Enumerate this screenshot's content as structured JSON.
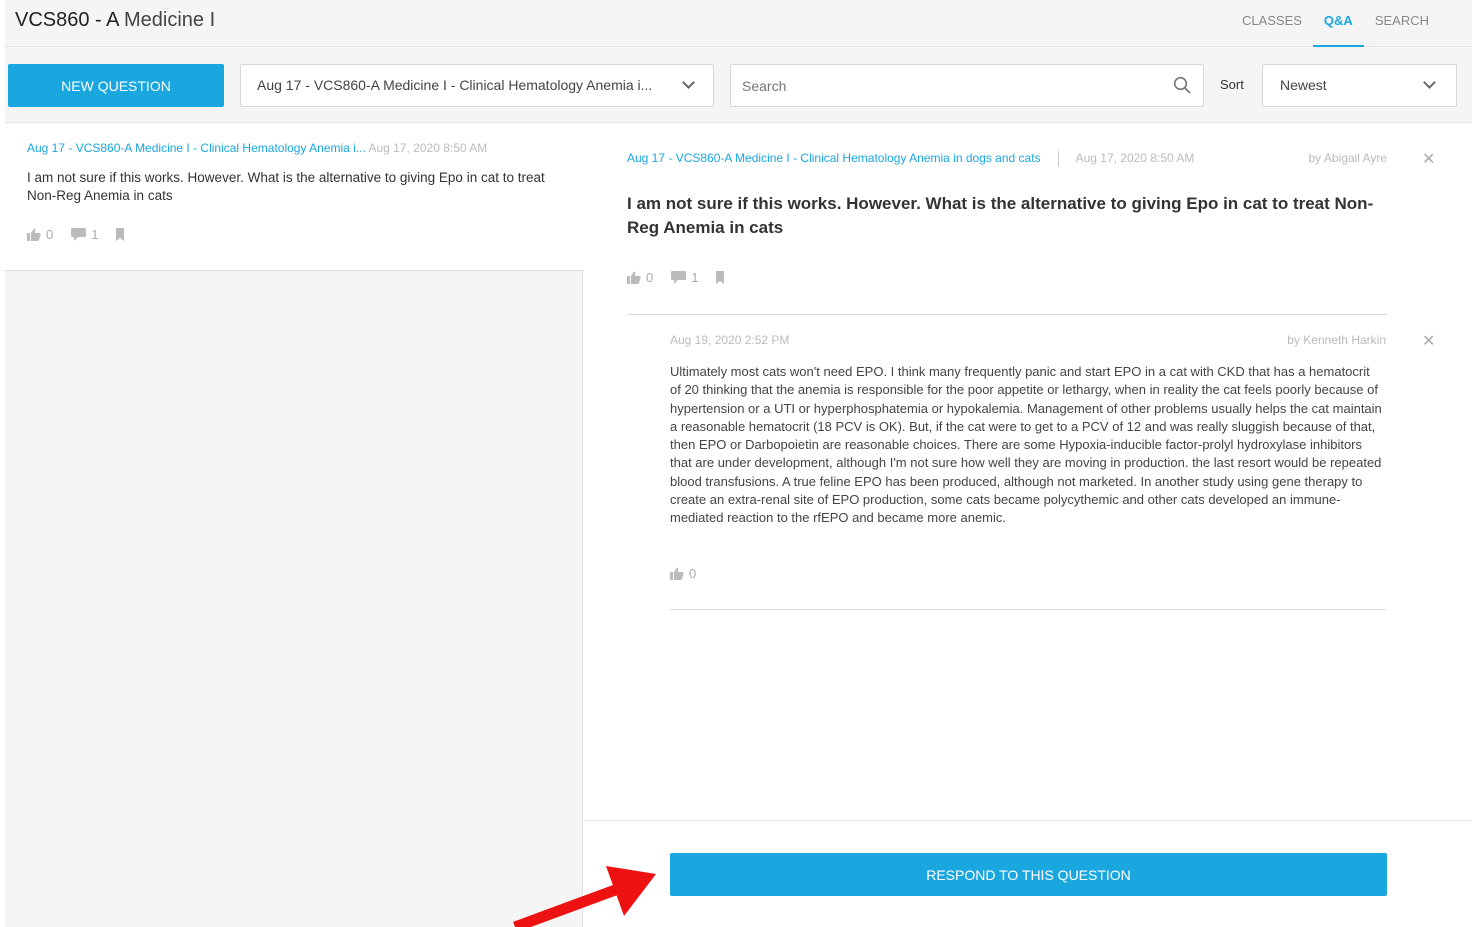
{
  "header": {
    "course_code": "VCS860 - A",
    "course_name": "Medicine I",
    "tabs": [
      "CLASSES",
      "Q&A",
      "SEARCH"
    ],
    "active_tab": "Q&A"
  },
  "toolbar": {
    "new_question_label": "NEW QUESTION",
    "class_selected": "Aug 17 - VCS860-A Medicine I - Clinical Hematology Anemia i...",
    "search_placeholder": "Search",
    "sort_label": "Sort",
    "sort_selected": "Newest"
  },
  "question_list": [
    {
      "class_link": "Aug 17 - VCS860-A Medicine I - Clinical Hematology Anemia i...",
      "timestamp": "Aug 17, 2020 8:50 AM",
      "text": "I am not sure if this works. However. What is the alternative to giving Epo in cat to treat Non-Reg Anemia in cats",
      "likes": "0",
      "comments": "1"
    }
  ],
  "question_detail": {
    "class_link": "Aug 17 - VCS860-A Medicine I - Clinical Hematology Anemia in dogs and cats",
    "timestamp": "Aug 17, 2020 8:50 AM",
    "author": "by Abigail Ayre",
    "title": "I am not sure if this works. However. What is the alternative to giving Epo in cat to treat Non-Reg Anemia in cats",
    "likes": "0",
    "comments": "1"
  },
  "answer": {
    "timestamp": "Aug 19, 2020 2:52 PM",
    "author": "by Kenneth Harkin",
    "body": "Ultimately most cats won't need EPO. I think many frequently panic and start EPO in a cat with CKD that has a hematocrit of 20 thinking that the anemia is responsible for the poor appetite or lethargy, when in reality the cat feels poorly because of hypertension or a UTI or hyperphosphatemia or hypokalemia. Management of other problems usually helps the cat maintain a reasonable hematocrit (18 PCV is OK). But, if the cat were to get to a PCV of 12 and was really sluggish because of that, then EPO or Darbopoietin are reasonable choices. There are some Hypoxia-inducible factor-prolyl hydroxylase inhibitors that are under development, although I'm not sure how well they are moving in production. the last resort would be repeated blood transfusions. A true feline EPO has been produced, although not marketed. In another study using gene therapy to create an extra-renal site of EPO production, some cats became polycythemic and other cats developed an immune-mediated reaction to the rfEPO and became more anemic.",
    "likes": "0"
  },
  "footer": {
    "respond_label": "RESPOND TO THIS QUESTION"
  },
  "colors": {
    "accent": "#1aa7e0",
    "annotation_arrow": "#ee1111"
  }
}
